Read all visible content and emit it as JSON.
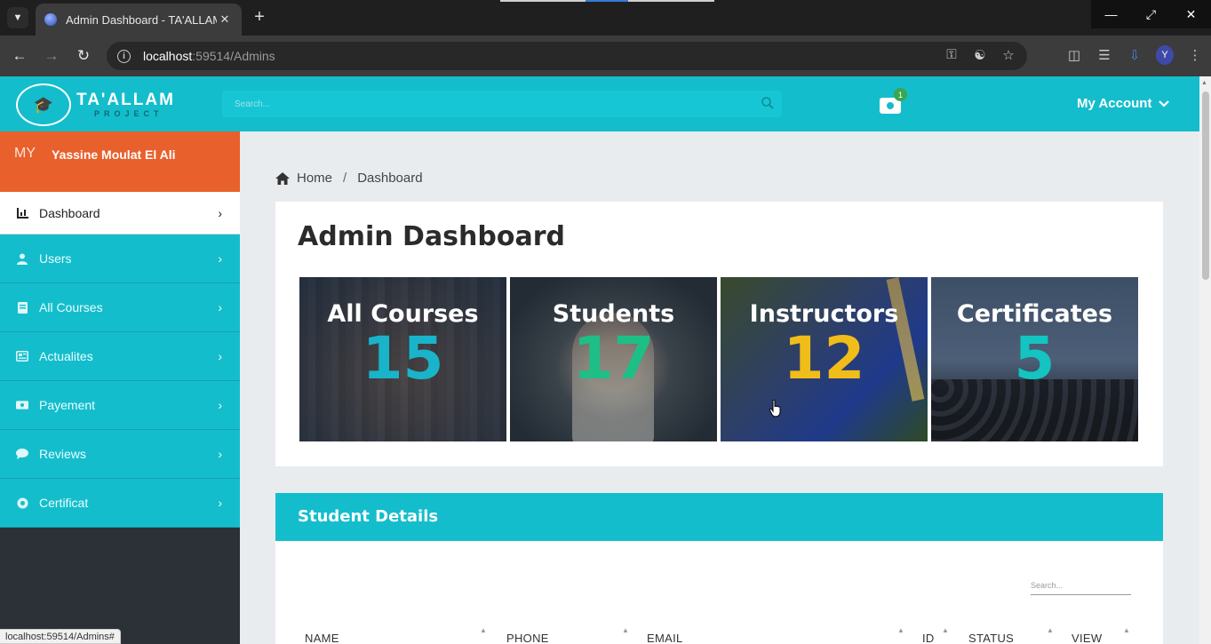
{
  "browser": {
    "tab_title": "Admin Dashboard - TA'ALLAM",
    "url_host": "localhost",
    "url_rest": ":59514/Admins",
    "status_url": "localhost:59514/Admins#",
    "profile_initial": "Y"
  },
  "header": {
    "brand_name": "TA'ALLAM",
    "brand_sub": "PROJECT",
    "search_placeholder": "Search...",
    "cart_count": "1",
    "account_label": "My Account"
  },
  "sidebar": {
    "user_initials": "MY",
    "user_name": "Yassine Moulat El Ali",
    "items": [
      {
        "label": "Dashboard",
        "icon": "chart-icon"
      },
      {
        "label": "Users",
        "icon": "user-icon"
      },
      {
        "label": "All Courses",
        "icon": "book-icon"
      },
      {
        "label": "Actualites",
        "icon": "newspaper-icon"
      },
      {
        "label": "Payement",
        "icon": "money-icon"
      },
      {
        "label": "Reviews",
        "icon": "comment-icon"
      },
      {
        "label": "Certificat",
        "icon": "certificate-icon"
      }
    ]
  },
  "breadcrumb": {
    "home": "Home",
    "separator": "/",
    "current": "Dashboard"
  },
  "dashboard": {
    "title": "Admin Dashboard",
    "stats": [
      {
        "label": "All Courses",
        "value": "15",
        "color": "#19b4c9"
      },
      {
        "label": "Students",
        "value": "17",
        "color": "#1dbf86"
      },
      {
        "label": "Instructors",
        "value": "12",
        "color": "#f1bd19"
      },
      {
        "label": "Certificates",
        "value": "5",
        "color": "#14c4c0"
      }
    ]
  },
  "student_details": {
    "title": "Student Details",
    "search_placeholder": "Search...",
    "columns": [
      "NAME",
      "PHONE",
      "EMAIL",
      "ID",
      "STATUS",
      "VIEW"
    ]
  },
  "colors": {
    "accent": "#14bdcc",
    "user_box": "#e8602c",
    "sidebar_bg": "#2c3137"
  }
}
